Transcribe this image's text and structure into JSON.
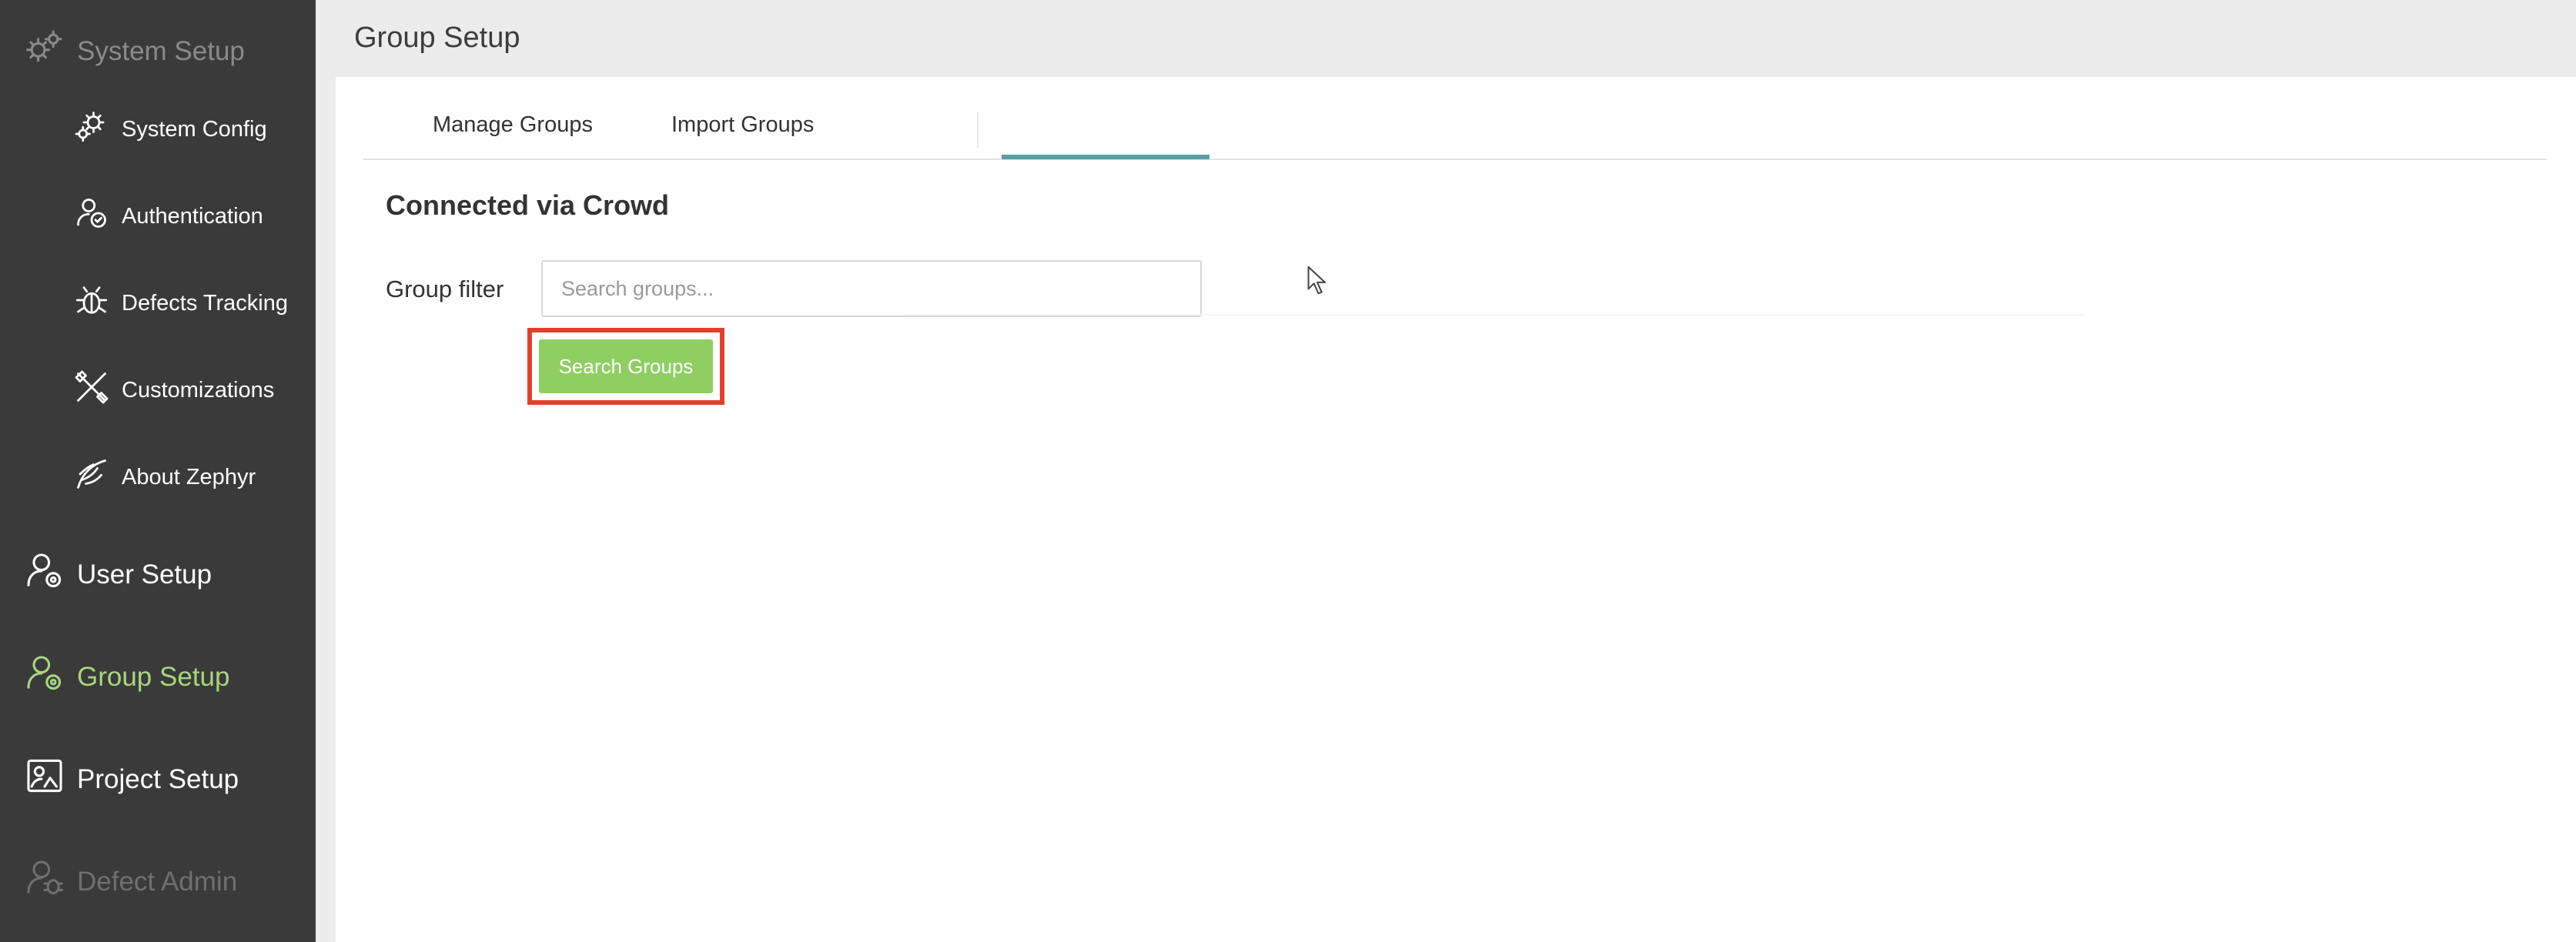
{
  "sidebar": {
    "system_setup": "System Setup",
    "system_config": "System Config",
    "authentication": "Authentication",
    "defects_tracking": "Defects Tracking",
    "customizations": "Customizations",
    "about_zephyr": "About Zephyr",
    "user_setup": "User Setup",
    "group_setup": "Group Setup",
    "project_setup": "Project Setup",
    "defect_admin": "Defect Admin"
  },
  "header": {
    "title": "Group Setup"
  },
  "tabs": {
    "manage": "Manage Groups",
    "import": "Import Groups"
  },
  "content": {
    "section_title": "Connected via Crowd",
    "filter_label": "Group filter",
    "search_placeholder": "Search groups...",
    "search_button": "Search Groups"
  },
  "colors": {
    "sidebar_bg": "#3a3a3a",
    "active_nav": "#a8d67e",
    "tab_underline": "#5a9fa1",
    "button_bg": "#8fcf62",
    "highlight": "#e0402b"
  }
}
